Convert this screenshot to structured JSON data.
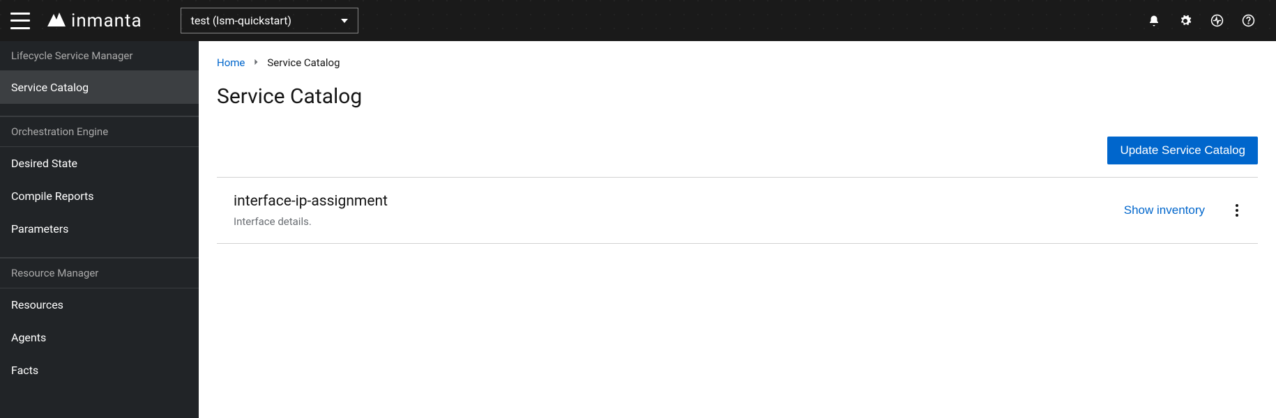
{
  "header": {
    "brand": "inmanta",
    "env_selector": "test (lsm-quickstart)"
  },
  "sidebar": {
    "sections": [
      {
        "header": "Lifecycle Service Manager",
        "items": [
          {
            "label": "Service Catalog",
            "active": true
          }
        ]
      },
      {
        "header": "Orchestration Engine",
        "items": [
          {
            "label": "Desired State",
            "active": false
          },
          {
            "label": "Compile Reports",
            "active": false
          },
          {
            "label": "Parameters",
            "active": false
          }
        ]
      },
      {
        "header": "Resource Manager",
        "items": [
          {
            "label": "Resources",
            "active": false
          },
          {
            "label": "Agents",
            "active": false
          },
          {
            "label": "Facts",
            "active": false
          }
        ]
      }
    ]
  },
  "breadcrumb": {
    "home": "Home",
    "current": "Service Catalog"
  },
  "page": {
    "title": "Service Catalog",
    "update_button": "Update Service Catalog"
  },
  "services": [
    {
      "name": "interface-ip-assignment",
      "description": "Interface details.",
      "inventory_label": "Show inventory"
    }
  ]
}
